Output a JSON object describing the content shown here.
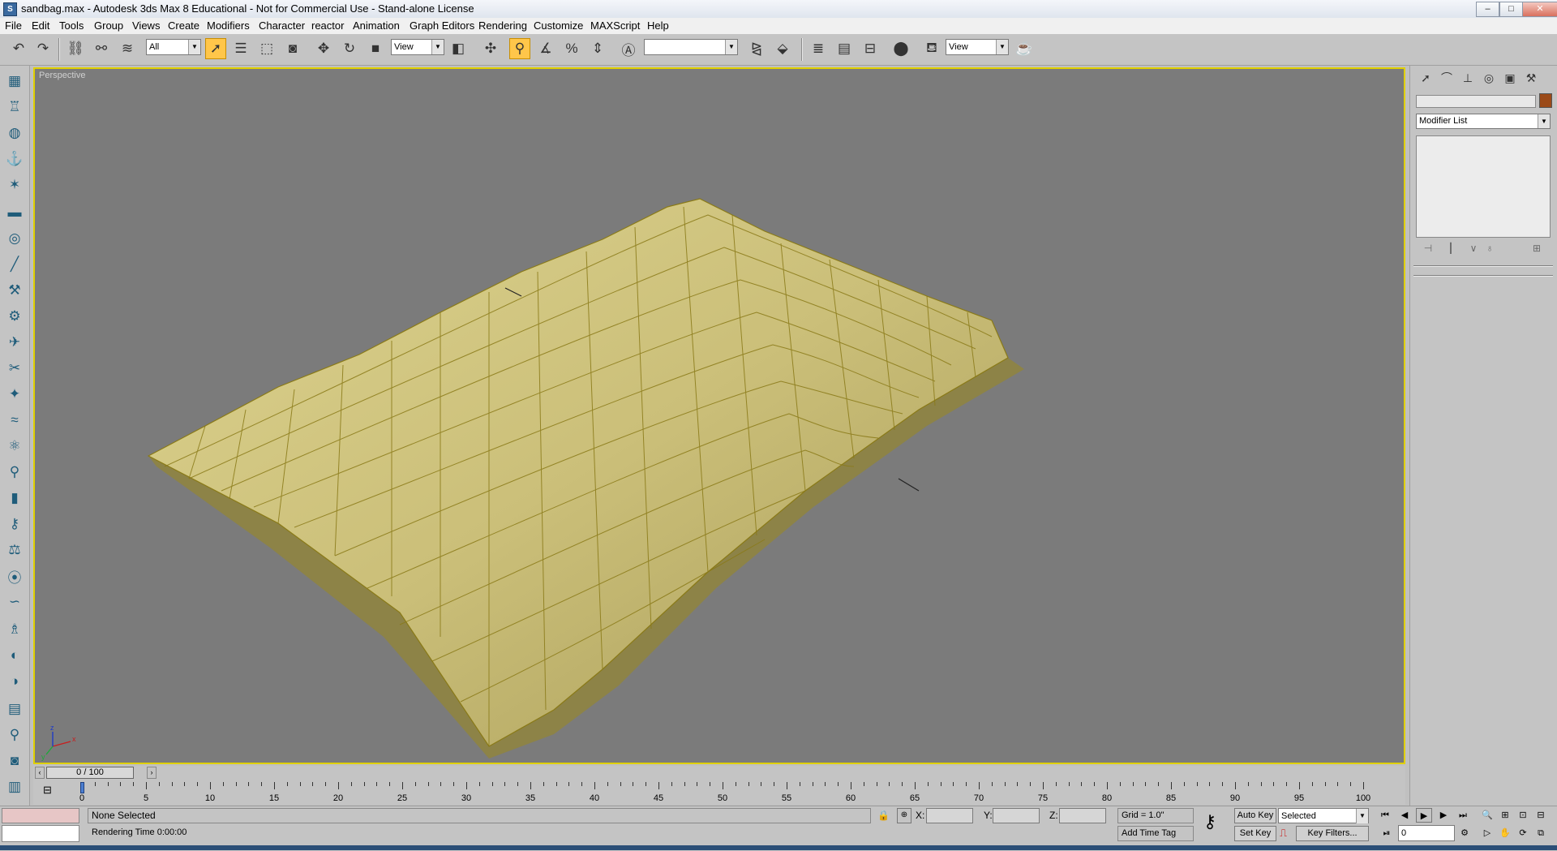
{
  "window": {
    "app_icon_letter": "S",
    "title": "sandbag.max - Autodesk 3ds Max 8  Educational - Not for Commercial Use - Stand-alone License",
    "controls": {
      "minimize": "–",
      "maximize": "□",
      "close": "✕"
    }
  },
  "menubar": {
    "items": [
      "File",
      "Edit",
      "Tools",
      "Group",
      "Views",
      "Create",
      "Modifiers",
      "Character",
      "reactor",
      "Animation",
      "Graph Editors",
      "Rendering",
      "Customize",
      "MAXScript",
      "Help"
    ]
  },
  "toolbar": {
    "selection_filter": "All",
    "reference_coord": "View",
    "named_selection": "",
    "render_type": "View"
  },
  "viewport": {
    "label": "Perspective",
    "background": "#7b7b7b",
    "active_border": "#e0d000",
    "mesh_color": "#c8bd78",
    "wire_color": "#8a7a18"
  },
  "command_panel": {
    "tab_icons": [
      "create-icon",
      "modify-icon",
      "hierarchy-icon",
      "motion-icon",
      "display-icon",
      "utilities-icon"
    ],
    "object_name": "",
    "object_color": "#9b4a18",
    "modifier_list": "Modifier List"
  },
  "time_slider": {
    "position": "0 / 100",
    "current_frame": 0,
    "total_frames": 100
  },
  "track_bar": {
    "labels": [
      "0",
      "5",
      "10",
      "15",
      "20",
      "25",
      "30",
      "35",
      "40",
      "45",
      "50",
      "55",
      "60",
      "65",
      "70",
      "75",
      "80",
      "85",
      "90",
      "95",
      "100"
    ]
  },
  "status": {
    "selection": "None Selected",
    "rendering_time": "Rendering Time  0:00:00",
    "x_label": "X:",
    "y_label": "Y:",
    "z_label": "Z:",
    "x_value": "",
    "y_value": "",
    "z_value": "",
    "grid": "Grid = 1.0\"",
    "add_time_tag": "Add Time Tag",
    "auto_key": "Auto Key",
    "set_key": "Set Key",
    "key_mode": "Selected",
    "key_filters": "Key Filters...",
    "frame": "0"
  }
}
